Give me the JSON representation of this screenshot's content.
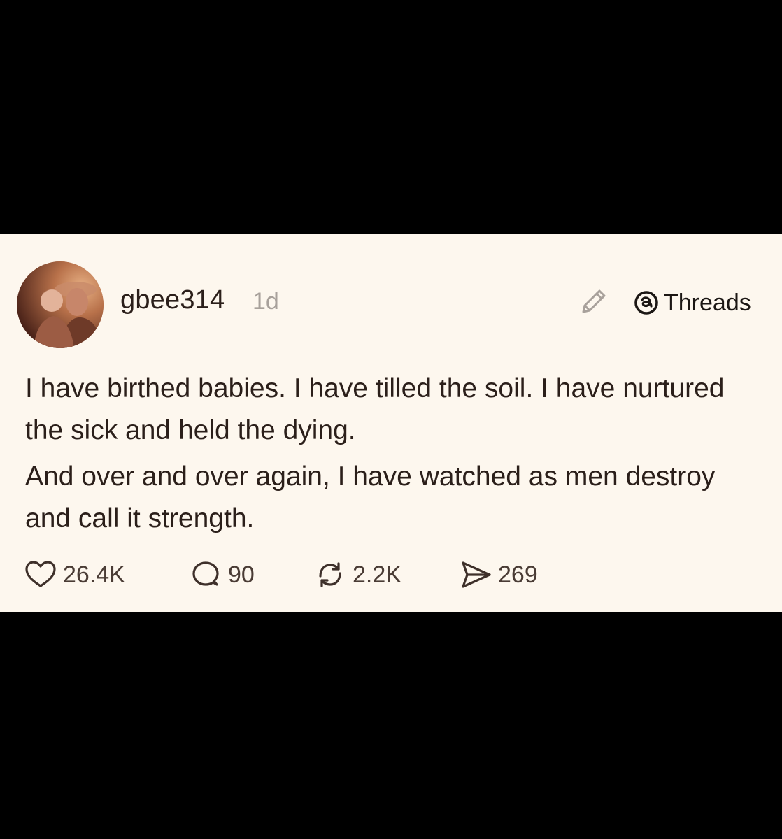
{
  "post": {
    "username": "gbee314",
    "time": "1d",
    "paragraphs": [
      "I have birthed babies. I have tilled the soil. I have nurtured the sick and held the dying.",
      "And over and over again, I have watched as men destroy and call it strength."
    ]
  },
  "header": {
    "edit_icon": "pencil-icon",
    "brand_icon": "threads-logo-icon",
    "brand_label": "Threads"
  },
  "actions": {
    "like": {
      "icon": "heart-icon",
      "count": "26.4K"
    },
    "reply": {
      "icon": "comment-icon",
      "count": "90"
    },
    "repost": {
      "icon": "repost-icon",
      "count": "2.2K"
    },
    "share": {
      "icon": "send-icon",
      "count": "269"
    }
  },
  "colors": {
    "background": "#000000",
    "card": "#fdf7ee",
    "text": "#2b1f1a",
    "muted": "#a8a19b"
  }
}
